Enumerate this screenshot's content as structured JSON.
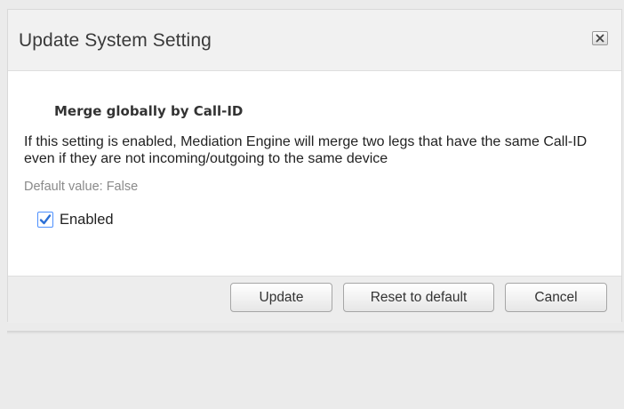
{
  "dialog": {
    "title": "Update System Setting",
    "close_icon": "close-x-icon"
  },
  "setting": {
    "name": "Merge globally by Call-ID",
    "description": "If this setting is enabled, Mediation Engine will merge two legs that have the same Call-ID even if they are not incoming/outgoing to the same device",
    "default_value_text": "Default value: False",
    "enabled_label": "Enabled",
    "enabled_checked": true
  },
  "buttons": {
    "update": "Update",
    "reset_to_default": "Reset to default",
    "cancel": "Cancel"
  },
  "colors": {
    "checkbox_accent": "#2b6fd6",
    "title_text": "#3a3a3a",
    "muted_text": "#8a8a8a"
  }
}
